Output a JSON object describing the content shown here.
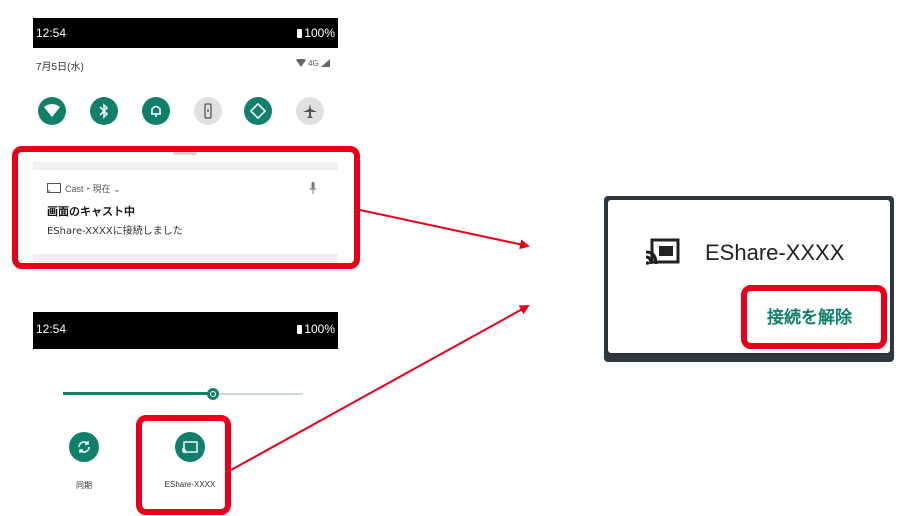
{
  "phone1": {
    "status": {
      "time": "12:54",
      "battery": "100%"
    },
    "date": "7月5日(水)",
    "network": "4G",
    "tiles": [
      {
        "name": "wifi",
        "state": "on"
      },
      {
        "name": "bluetooth",
        "state": "on"
      },
      {
        "name": "sound",
        "state": "on"
      },
      {
        "name": "flashlight",
        "state": "off"
      },
      {
        "name": "auto-rotate",
        "state": "on"
      },
      {
        "name": "airplane",
        "state": "off"
      }
    ],
    "notification": {
      "header": "Cast・現在 ⌄",
      "title": "画面のキャスト中",
      "text": "EShare-XXXXに接続しました"
    }
  },
  "phone2": {
    "status": {
      "time": "12:54",
      "battery": "100%"
    },
    "brightness_level": 0.62,
    "tiles": [
      {
        "name": "sync",
        "label": "同期"
      },
      {
        "name": "cast",
        "label": "EShare-XXXX"
      }
    ]
  },
  "popup": {
    "device": "EShare-XXXX",
    "disconnect_label": "接続を解除"
  },
  "colors": {
    "accent": "#11806a",
    "highlight": "#e8001a"
  }
}
